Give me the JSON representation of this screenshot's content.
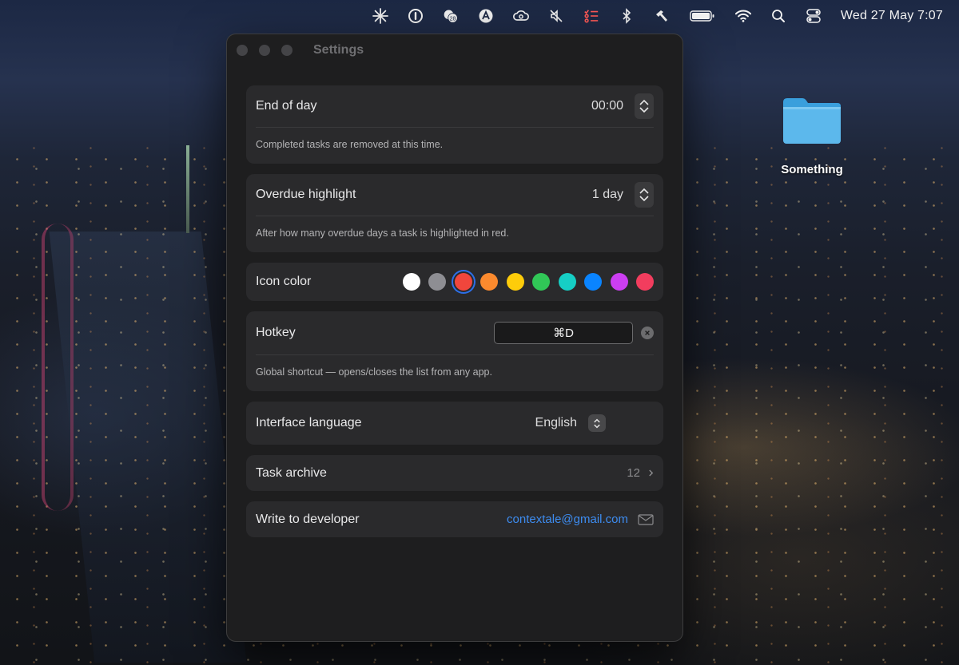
{
  "menubar": {
    "icons": [
      "sparkle-icon",
      "onepassword-icon",
      "calendar-badge-icon",
      "transmit-icon",
      "creative-cloud-icon",
      "mute-icon",
      "task-list-icon",
      "bluetooth-icon",
      "hammer-icon",
      "battery-icon",
      "wifi-icon",
      "search-icon",
      "control-center-icon"
    ],
    "calendar_badge": "28",
    "clock": "Wed 27 May  7:07"
  },
  "desktop": {
    "folder_label": "Something"
  },
  "window": {
    "title": "Settings",
    "end_of_day": {
      "label": "End of day",
      "value": "00:00",
      "description": "Completed tasks are removed at this time."
    },
    "overdue": {
      "label": "Overdue highlight",
      "value": "1 day",
      "description": "After how many overdue days a task is highlighted in red."
    },
    "icon_color": {
      "label": "Icon color",
      "colors": [
        "#ffffff",
        "#8e8e93",
        "#f0463c",
        "#fb8a2e",
        "#fecc0a",
        "#31c757",
        "#16cfc5",
        "#0a84ff",
        "#cc3ef2",
        "#f23d5e"
      ],
      "selected_index": 2
    },
    "hotkey": {
      "label": "Hotkey",
      "value": "⌘D",
      "description": "Global shortcut — opens/closes the list from any app."
    },
    "language": {
      "label": "Interface language",
      "value": "English"
    },
    "archive": {
      "label": "Task archive",
      "count": "12"
    },
    "developer": {
      "label": "Write to developer",
      "email": "contextale@gmail.com"
    }
  }
}
